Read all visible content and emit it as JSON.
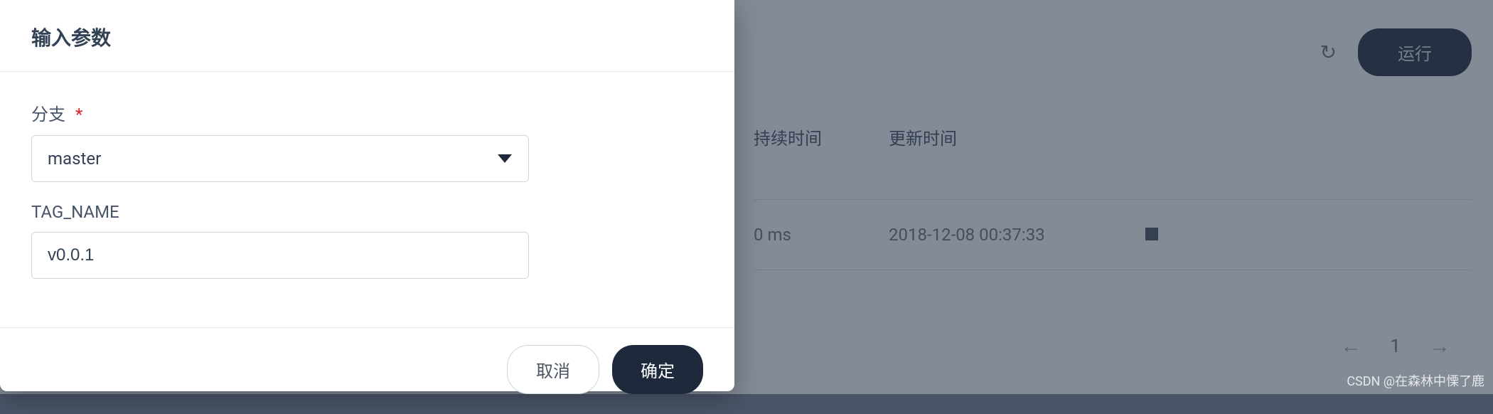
{
  "modal": {
    "title": "输入参数",
    "branch_label": "分支",
    "branch_required_star": "*",
    "branch_value": "master",
    "tag_name_label": "TAG_NAME",
    "tag_name_value": "v0.0.1",
    "cancel_label": "取消",
    "confirm_label": "确定"
  },
  "background": {
    "run_button_label": "运行",
    "table": {
      "headers": {
        "duration": "持续时间",
        "update_time": "更新时间"
      },
      "row": {
        "duration": "0 ms",
        "update_time": "2018-12-08 00:37:33"
      }
    },
    "pagination": {
      "current": "1"
    }
  },
  "watermark": "CSDN @在森林中慄了鹿"
}
